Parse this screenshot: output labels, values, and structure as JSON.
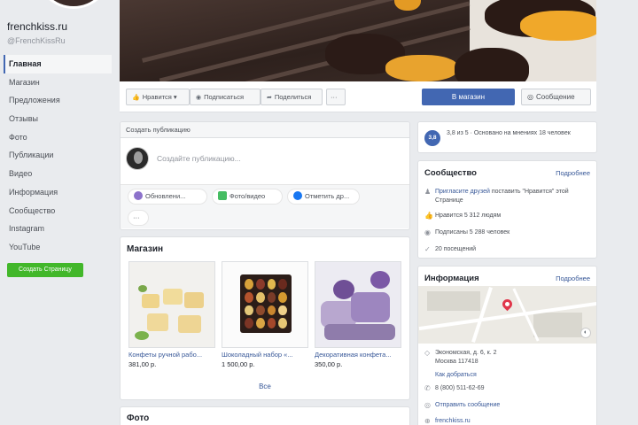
{
  "page": {
    "name": "frenchkiss.ru",
    "handle": "@FrenchKissRu"
  },
  "sidebar": {
    "items": [
      {
        "label": "Главная"
      },
      {
        "label": "Магазин"
      },
      {
        "label": "Предложения"
      },
      {
        "label": "Отзывы"
      },
      {
        "label": "Фото"
      },
      {
        "label": "Публикации"
      },
      {
        "label": "Видео"
      },
      {
        "label": "Информация"
      },
      {
        "label": "Сообщество"
      },
      {
        "label": "Instagram"
      },
      {
        "label": "YouTube"
      }
    ],
    "create_label": "Создать Страницу"
  },
  "actions": {
    "like": "Нравится ▾",
    "follow": "Подписаться",
    "share": "Поделиться",
    "more": "···",
    "shop": "В магазин",
    "message": "Сообщение"
  },
  "composer": {
    "title": "Создать публикацию",
    "placeholder": "Создайте публикацию...",
    "actions": [
      "Обновлени...",
      "Фото/видео",
      "Отметить др...",
      "···"
    ]
  },
  "shop": {
    "title": "Магазин",
    "products": [
      {
        "name": "Конфеты ручной рабо...",
        "price": "381,00 р."
      },
      {
        "name": "Шоколадный набор «...",
        "price": "1 500,00 р."
      },
      {
        "name": "Декоративная конфета...",
        "price": "350,00 р."
      }
    ],
    "all_label": "Все"
  },
  "photos": {
    "title": "Фото"
  },
  "rating": {
    "score": "3,8",
    "text": "3,8 из 5 · Основано на мнениях 18 человек"
  },
  "community": {
    "title": "Сообщество",
    "more": "Подробнее",
    "invite_link": "Пригласите друзей",
    "invite_rest": " поставить \"Нравится\" этой Странице",
    "likes": "Нравится 5 312 людям",
    "followers": "Подписаны 5 288 человек",
    "visits": "20 посещений"
  },
  "info": {
    "title": "Информация",
    "more": "Подробнее",
    "address": "Экономская, д. 6, к. 2\nМосква 117418",
    "directions": "Как добраться",
    "phone": "8 (800) 511-62-69",
    "send_message": "Отправить сообщение",
    "website": "frenchkiss.ru"
  }
}
